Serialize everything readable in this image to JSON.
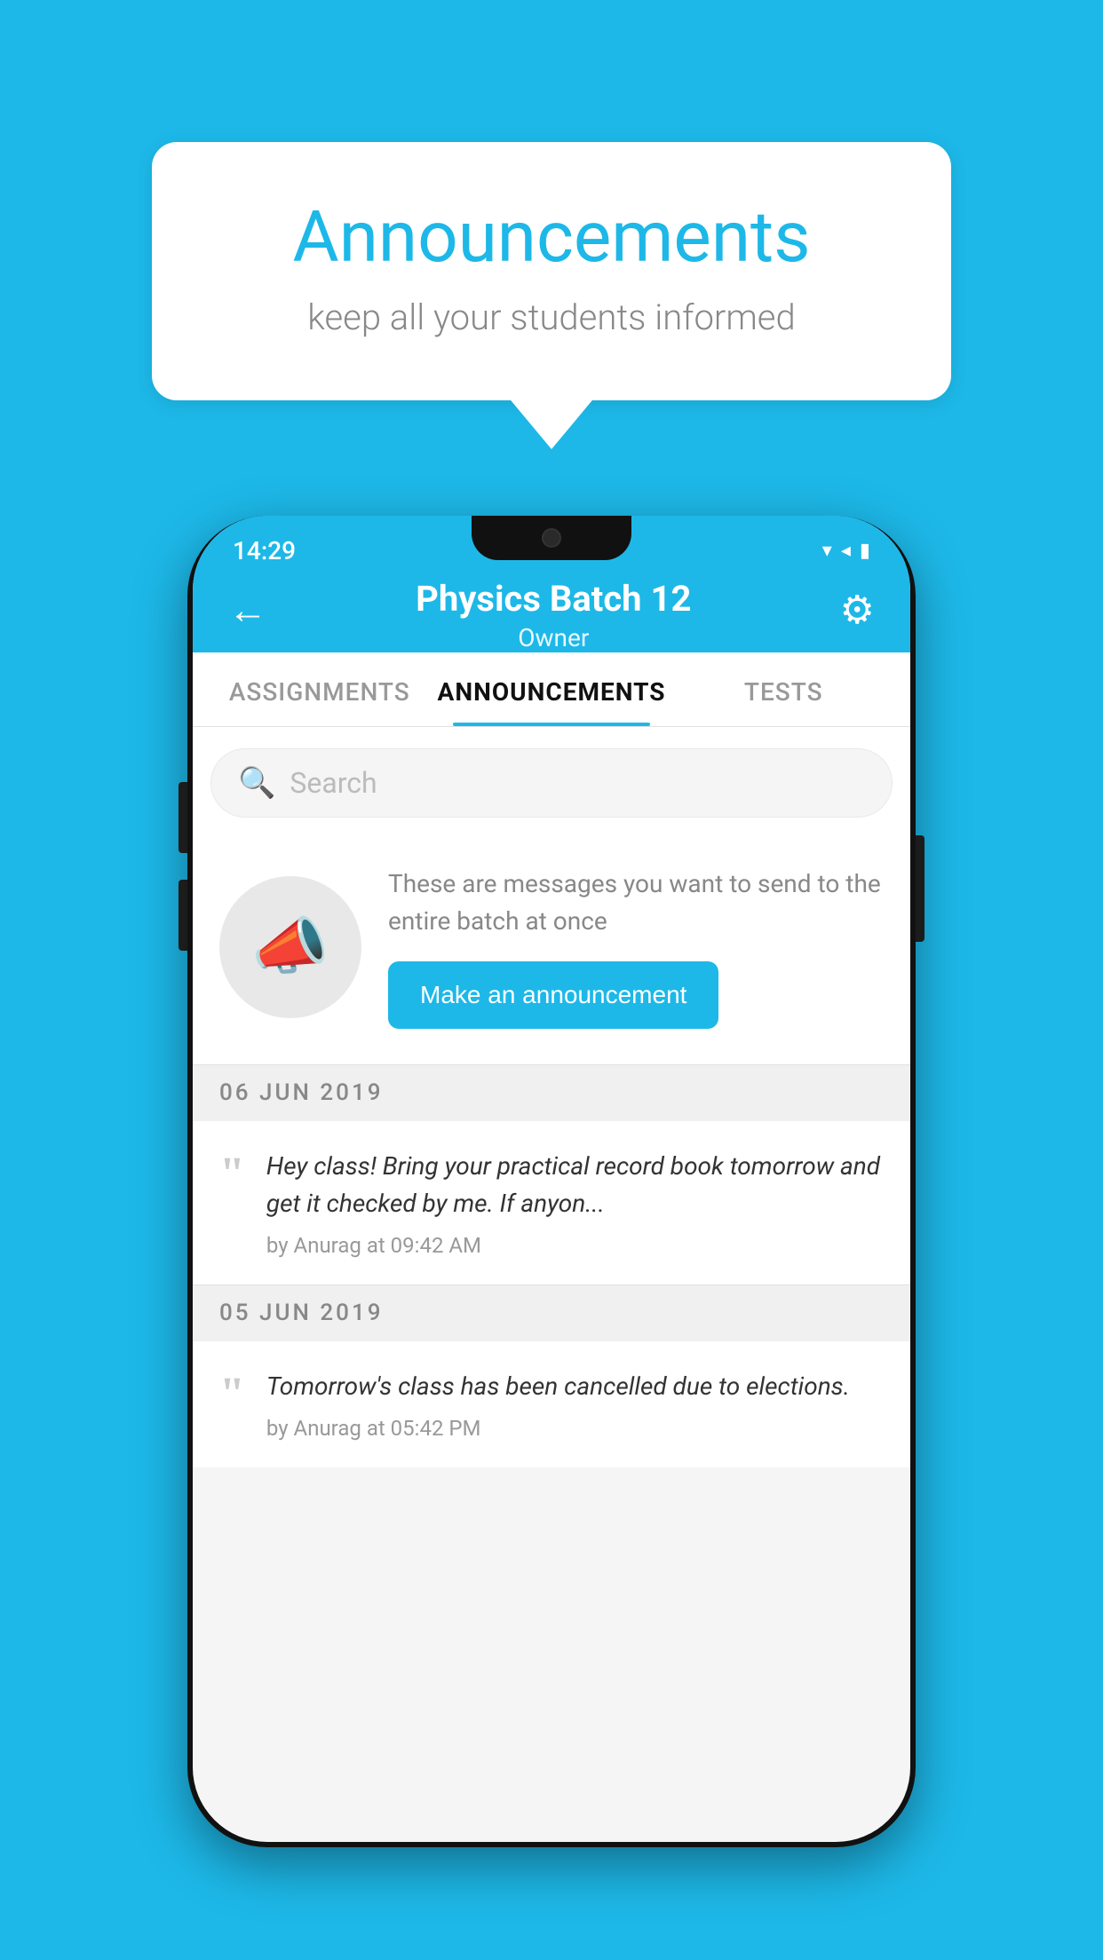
{
  "background_color": "#1db8e8",
  "bubble": {
    "title": "Announcements",
    "subtitle": "keep all your students informed"
  },
  "phone": {
    "status_bar": {
      "time": "14:29",
      "icons": "▾◂▮"
    },
    "header": {
      "back_label": "←",
      "title": "Physics Batch 12",
      "subtitle": "Owner",
      "gear_label": "⚙"
    },
    "tabs": [
      {
        "label": "ASSIGNMENTS",
        "active": false
      },
      {
        "label": "ANNOUNCEMENTS",
        "active": true
      },
      {
        "label": "TESTS",
        "active": false
      }
    ],
    "search": {
      "placeholder": "Search"
    },
    "announcement_card": {
      "description": "These are messages you want to send to the entire batch at once",
      "button_label": "Make an announcement"
    },
    "date_groups": [
      {
        "date": "06  JUN  2019",
        "messages": [
          {
            "text": "Hey class! Bring your practical record book tomorrow and get it checked by me. If anyon...",
            "meta": "by Anurag at 09:42 AM"
          }
        ]
      },
      {
        "date": "05  JUN  2019",
        "messages": [
          {
            "text": "Tomorrow's class has been cancelled due to elections.",
            "meta": "by Anurag at 05:42 PM"
          }
        ]
      }
    ]
  }
}
